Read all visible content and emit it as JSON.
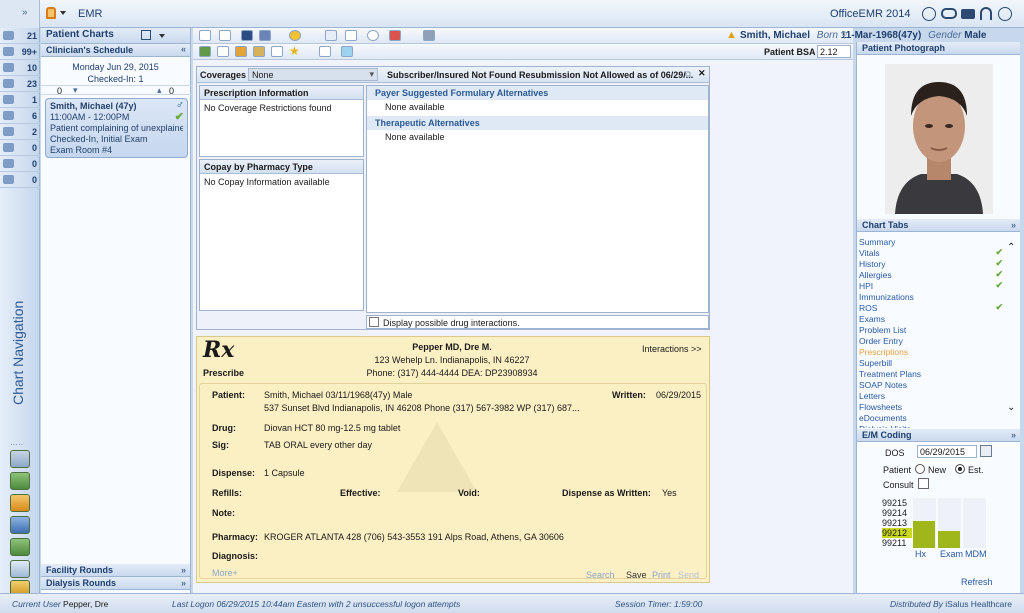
{
  "app": {
    "title": "EMR",
    "brand": "OfficeEMR 2014"
  },
  "leftnav": {
    "label": "Chart Navigation",
    "items": [
      {
        "icon": "mail-icon",
        "count": "21"
      },
      {
        "icon": "people-icon",
        "count": "99+"
      },
      {
        "icon": "calendar-icon",
        "count": "10"
      },
      {
        "icon": "clipboard-icon",
        "count": "23"
      },
      {
        "icon": "folder-icon",
        "count": "1"
      },
      {
        "icon": "pill-icon",
        "count": "6"
      },
      {
        "icon": "arrow-icon",
        "count": "2"
      },
      {
        "icon": "lab-icon",
        "count": "0"
      },
      {
        "icon": "phone-icon",
        "count": "0"
      },
      {
        "icon": "building-icon",
        "count": "0"
      }
    ]
  },
  "schedule": {
    "header": "Patient Charts",
    "subheader": "Clinician's Schedule",
    "date": "Monday Jun 29, 2015",
    "checked_in": "Checked-In: 1",
    "left_count": "0",
    "right_count": "0",
    "appt": {
      "name": "Smith, Michael (47y)",
      "time": "11:00AM - 12:00PM",
      "complaint": "Patient complaining of unexplained",
      "status": "Checked-In, Initial Exam",
      "room": "Exam Room #4"
    },
    "facility_rounds": "Facility Rounds",
    "dialysis_rounds": "Dialysis Rounds"
  },
  "patient": {
    "name": "Smith, Michael",
    "born_label": "Born",
    "born": "11-Mar-1968(47y)",
    "gender_label": "Gender",
    "gender": "Male",
    "bsa_label": "Patient BSA",
    "bsa": "2.12"
  },
  "coverage": {
    "label": "Coverages",
    "value": "None",
    "notice": "Subscriber/Insured Not Found Resubmission Not Allowed  as of 06/29/...",
    "prescription_info_header": "Prescription Information",
    "prescription_info": "No Coverage Restrictions found",
    "copay_header": "Copay by Pharmacy Type",
    "copay": "No Copay Information available",
    "payer_header": "Payer Suggested Formulary Alternatives",
    "payer_value": "None available",
    "therapeutic_header": "Therapeutic Alternatives",
    "therapeutic_value": "None available",
    "drug_interactions": "Display possible drug interactions."
  },
  "rx": {
    "symbol": "Rx",
    "prescribe": "Prescribe",
    "doctor": "Pepper MD, Dre M.",
    "address": "123 Wehelp Ln. Indianapolis, IN 46227",
    "phone": "Phone: (317) 444-4444  DEA: DP23908934",
    "interactions": "Interactions >>",
    "patient_label": "Patient:",
    "patient_line1": "Smith, Michael 03/11/1968(47y) Male",
    "patient_line2": "537 Sunset Blvd Indianapolis, IN 46208     Phone (317) 567-3982 WP (317) 687...",
    "written_label": "Written:",
    "written": "06/29/2015",
    "drug_label": "Drug:",
    "drug": "Diovan HCT 80 mg-12.5 mg tablet",
    "sig_label": "Sig:",
    "sig": "TAB ORAL every other day",
    "dispense_label": "Dispense:",
    "dispense": "1 Capsule",
    "refills_label": "Refills:",
    "effective_label": "Effective:",
    "void_label": "Void:",
    "daw_label": "Dispense as Written:",
    "daw": "Yes",
    "note_label": "Note:",
    "pharmacy_label": "Pharmacy:",
    "pharmacy": "KROGER ATLANTA 428   (706) 543-3553   191 Alps Road, Athens, GA 30606",
    "diagnosis_label": "Diagnosis:",
    "more": "More+",
    "actions": {
      "search": "Search",
      "save": "Save",
      "print": "Print",
      "send": "Send"
    }
  },
  "right": {
    "photo_header": "Patient Photograph",
    "tabs_header": "Chart Tabs",
    "tabs": [
      {
        "label": "Summary",
        "check": ""
      },
      {
        "label": "Vitals",
        "check": "✔"
      },
      {
        "label": "History",
        "check": "✔"
      },
      {
        "label": "Allergies",
        "check": "✔"
      },
      {
        "label": "HPI",
        "check": "✔"
      },
      {
        "label": "Immunizations",
        "check": ""
      },
      {
        "label": "ROS",
        "check": "✔"
      },
      {
        "label": "Exams",
        "check": ""
      },
      {
        "label": "Problem List",
        "check": ""
      },
      {
        "label": "Order Entry",
        "check": ""
      },
      {
        "label": "Prescriptions",
        "check": ""
      },
      {
        "label": "Superbill",
        "check": ""
      },
      {
        "label": "Treatment Plans",
        "check": ""
      },
      {
        "label": "SOAP Notes",
        "check": ""
      },
      {
        "label": "Letters",
        "check": ""
      },
      {
        "label": "Flowsheets",
        "check": ""
      },
      {
        "label": "eDocuments",
        "check": ""
      },
      {
        "label": "Dialysis Visits",
        "check": ""
      }
    ],
    "em_header": "E/M Coding",
    "dos_label": "DOS",
    "dos": "06/29/2015",
    "patient_label": "Patient",
    "new_label": "New",
    "est_label": "Est.",
    "consult_label": "Consult",
    "codes": [
      "99215",
      "99214",
      "99213",
      "99212",
      "99211"
    ],
    "selected_code": "99212",
    "bar_labels": [
      "Hx",
      "Exam",
      "MDM"
    ],
    "bar_levels": [
      0.55,
      0.35,
      0
    ],
    "refresh": "Refresh"
  },
  "status": {
    "user_label": "Current User",
    "user": "Pepper, Dre",
    "logon_label": "Last Logon",
    "logon": "06/29/2015 10:44am Eastern  with 2 unsuccessful logon attempts",
    "timer_label": "Session Timer:",
    "timer": "1:59:00",
    "dist_label": "Distributed By",
    "dist": "iSalus Healthcare"
  },
  "colors": {
    "accent": "#1f3f6e",
    "rx_bg": "#fbefc4",
    "link": "#2a5aa4",
    "selected_tab": "#e8a33a",
    "check": "#6aa93b"
  }
}
